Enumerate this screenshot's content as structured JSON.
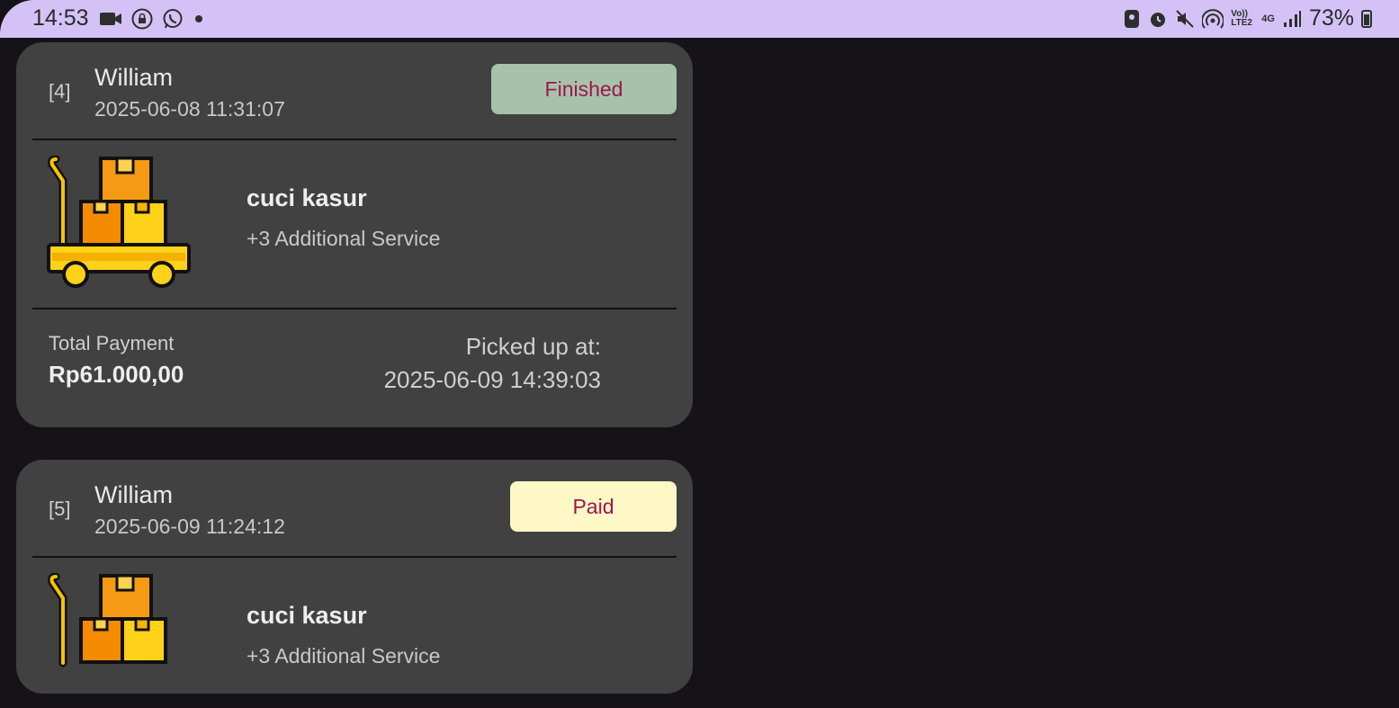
{
  "status_bar": {
    "time": "14:53",
    "battery": "73%",
    "icons_left": [
      "video-camera-icon",
      "lock-icon",
      "whatsapp-icon",
      "dot-icon"
    ],
    "icons_right": [
      "face-icon",
      "alarm-icon",
      "mute-icon",
      "hotspot-icon",
      "volte-icon",
      "4g-icon",
      "signal-icon",
      "battery-icon"
    ],
    "volte_label": "Vo)) LTE2",
    "network_label": "4G"
  },
  "orders": [
    {
      "index": "[4]",
      "customer": "William",
      "date": "2025-06-08 11:31:07",
      "status": "Finished",
      "status_color": "#a6c3a9",
      "service": "cuci kasur",
      "additional": "+3 Additional Service",
      "total_label": "Total Payment",
      "total_value": "Rp61.000,00",
      "pickup_label": "Picked up at:",
      "pickup_value": "2025-06-09 14:39:03"
    },
    {
      "index": "[5]",
      "customer": "William",
      "date": "2025-06-09 11:24:12",
      "status": "Paid",
      "status_color": "#fef8c6",
      "service": "cuci kasur",
      "additional": "+3 Additional Service"
    }
  ]
}
